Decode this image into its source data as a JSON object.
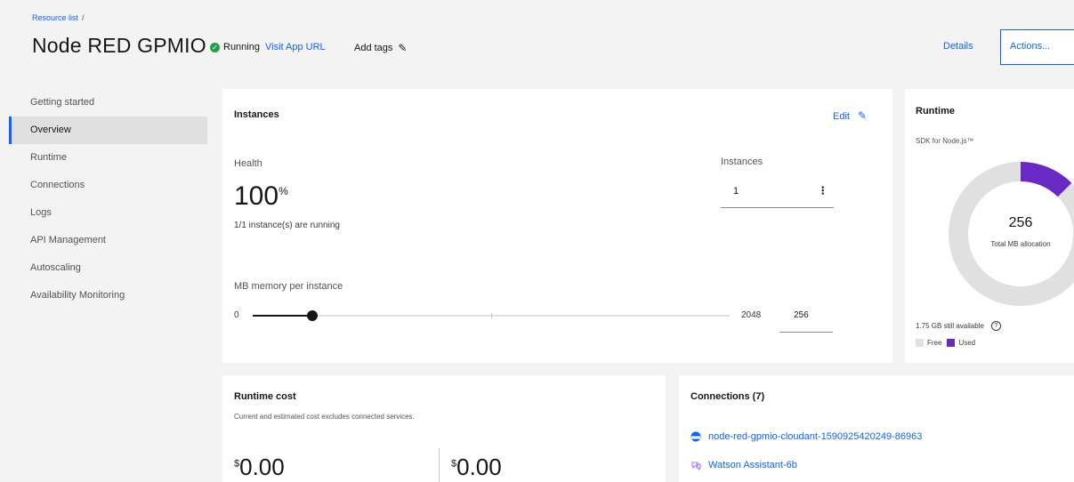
{
  "header": {
    "breadcrumb": "Resource list",
    "breadcrumb_sep": "/",
    "title": "Node RED GPMIO",
    "status": "Running",
    "visit_url": "Visit App URL",
    "add_tags": "Add tags",
    "details": "Details",
    "actions": "Actions..."
  },
  "sidebar": {
    "items": [
      {
        "label": "Getting started"
      },
      {
        "label": "Overview",
        "active": true
      },
      {
        "label": "Runtime"
      },
      {
        "label": "Connections"
      },
      {
        "label": "Logs"
      },
      {
        "label": "API Management"
      },
      {
        "label": "Autoscaling"
      },
      {
        "label": "Availability Monitoring"
      }
    ]
  },
  "instances": {
    "title": "Instances",
    "edit": "Edit",
    "health_label": "Health",
    "health_value": "100",
    "health_unit": "%",
    "health_sub": "1/1 instance(s) are running",
    "instances_label": "Instances",
    "instances_value": "1",
    "memory_label": "MB memory per instance",
    "slider_min": "0",
    "slider_max": "2048",
    "memory_value": "256",
    "slider_fraction": 0.125
  },
  "runtime": {
    "title": "Runtime",
    "sdk": "SDK for Node.js™",
    "allocation_value": "256",
    "allocation_label": "Total MB allocation",
    "used_fraction": 0.125,
    "available": "1.75 GB still available",
    "legend_free": "Free",
    "legend_used": "Used",
    "colors": {
      "free": "#e0e0e0",
      "used": "#6929c4"
    }
  },
  "cost": {
    "title": "Runtime cost",
    "desc": "Current and estimated cost excludes connected services.",
    "currency": "$",
    "current": "0.00",
    "estimated": "0.00"
  },
  "connections": {
    "title": "Connections (7)",
    "items": [
      {
        "label": "node-red-gpmio-cloudant-1590925420249-86963",
        "icon": "cloudant-icon"
      },
      {
        "label": "Watson Assistant-6b",
        "icon": "watson-assistant-icon"
      }
    ]
  }
}
